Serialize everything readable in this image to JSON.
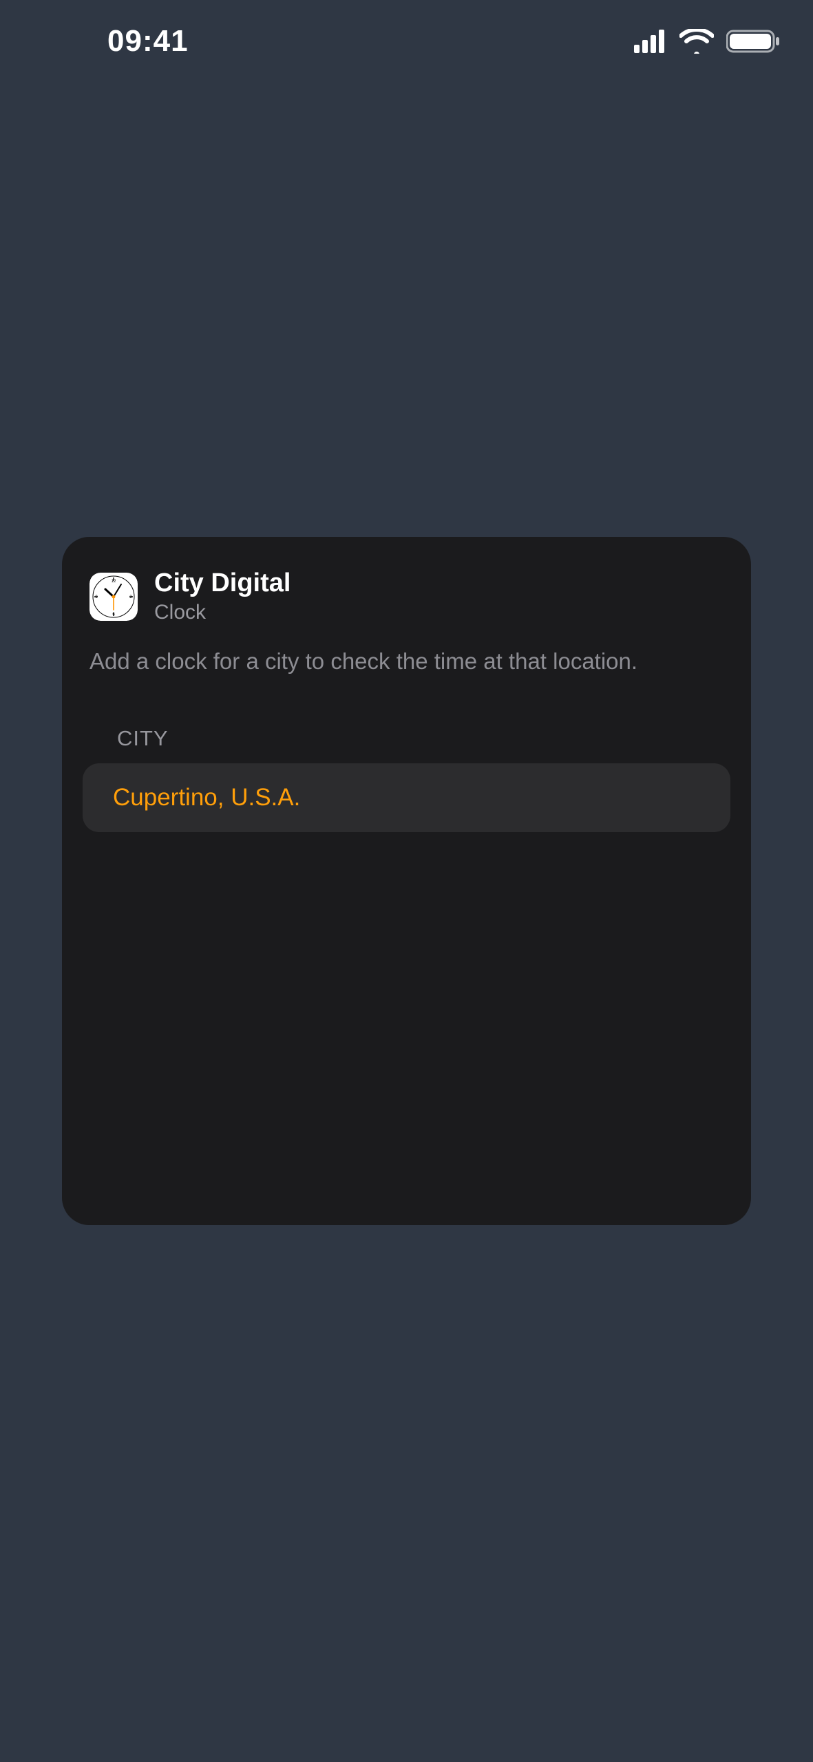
{
  "status_bar": {
    "time": "09:41"
  },
  "card": {
    "title": "City Digital",
    "subtitle": "Clock",
    "description": "Add a clock for a city to check the time at that location.",
    "section_label": "CITY",
    "city_value": "Cupertino, U.S.A."
  },
  "colors": {
    "bg": "#2f3744",
    "card_bg": "#1b1b1d",
    "row_bg": "#2c2c2e",
    "accent": "#ff9f0a",
    "muted": "#9a9aa0"
  }
}
